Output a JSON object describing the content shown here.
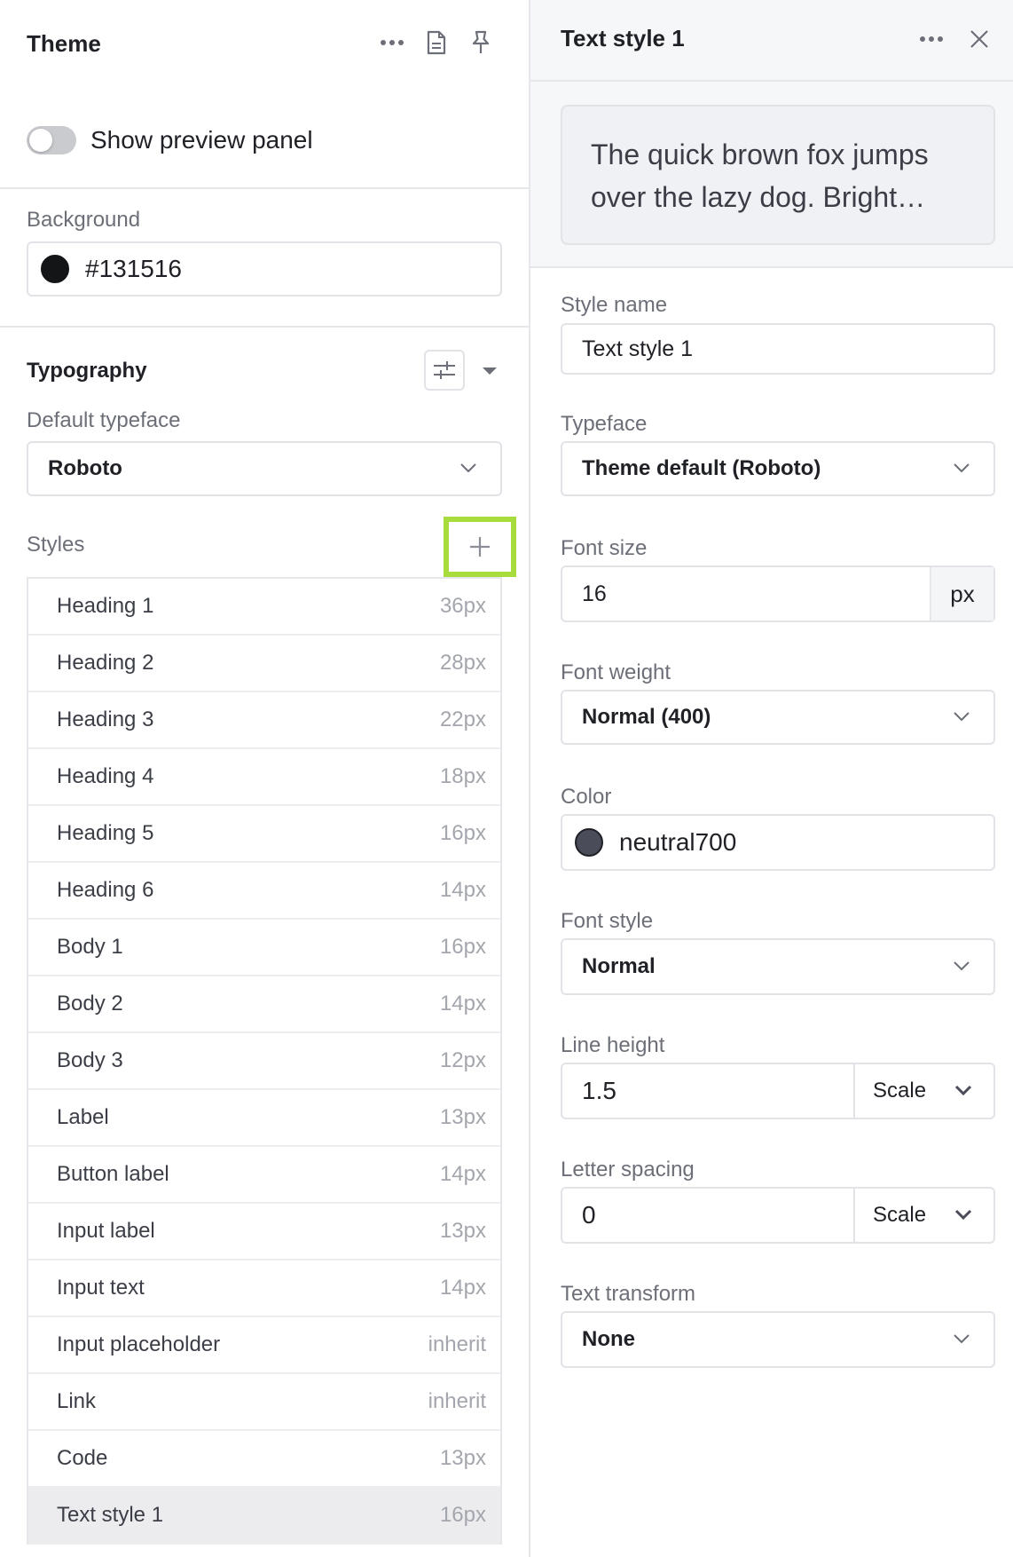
{
  "left_panel": {
    "title": "Theme",
    "toggle_label": "Show preview panel",
    "background": {
      "label": "Background",
      "value": "#131516",
      "swatch_color": "#131516"
    },
    "typography": {
      "title": "Typography",
      "default_typeface_label": "Default typeface",
      "default_typeface_value": "Roboto",
      "styles_label": "Styles",
      "styles": [
        {
          "name": "Heading 1",
          "size": "36px"
        },
        {
          "name": "Heading 2",
          "size": "28px"
        },
        {
          "name": "Heading 3",
          "size": "22px"
        },
        {
          "name": "Heading 4",
          "size": "18px"
        },
        {
          "name": "Heading 5",
          "size": "16px"
        },
        {
          "name": "Heading 6",
          "size": "14px"
        },
        {
          "name": "Body 1",
          "size": "16px"
        },
        {
          "name": "Body 2",
          "size": "14px"
        },
        {
          "name": "Body 3",
          "size": "12px"
        },
        {
          "name": "Label",
          "size": "13px"
        },
        {
          "name": "Button label",
          "size": "14px"
        },
        {
          "name": "Input label",
          "size": "13px"
        },
        {
          "name": "Input text",
          "size": "14px"
        },
        {
          "name": "Input placeholder",
          "size": "inherit"
        },
        {
          "name": "Link",
          "size": "inherit"
        },
        {
          "name": "Code",
          "size": "13px"
        },
        {
          "name": "Text style 1",
          "size": "16px",
          "selected": true
        }
      ]
    }
  },
  "right_panel": {
    "title": "Text style 1",
    "preview_text": "The quick brown fox jumps over the lazy dog. Bright…",
    "style_name_label": "Style name",
    "style_name_value": "Text style 1",
    "typeface_label": "Typeface",
    "typeface_value": "Theme default (Roboto)",
    "font_size_label": "Font size",
    "font_size_value": "16",
    "font_size_unit": "px",
    "font_weight_label": "Font weight",
    "font_weight_value": "Normal (400)",
    "color_label": "Color",
    "color_value": "neutral700",
    "color_swatch": "#4a4d59",
    "font_style_label": "Font style",
    "font_style_value": "Normal",
    "line_height_label": "Line height",
    "line_height_value": "1.5",
    "line_height_unit": "Scale",
    "letter_spacing_label": "Letter spacing",
    "letter_spacing_value": "0",
    "letter_spacing_unit": "Scale",
    "text_transform_label": "Text transform",
    "text_transform_value": "None"
  },
  "colors": {
    "highlight": "#a8dc3c"
  }
}
